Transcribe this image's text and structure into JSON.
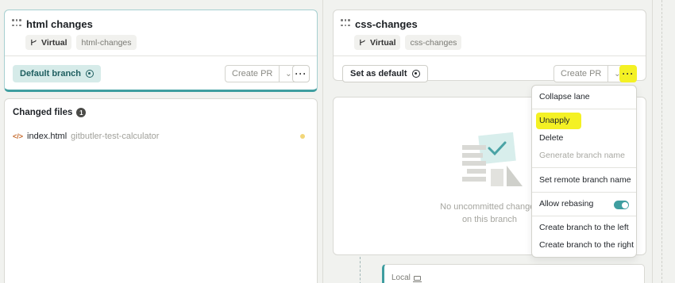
{
  "lanes": [
    {
      "title": "html changes",
      "tag_type": "Virtual",
      "tag_branch": "html-changes",
      "default_label": "Default branch",
      "create_pr": "Create PR"
    },
    {
      "title": "css-changes",
      "tag_type": "Virtual",
      "tag_branch": "css-changes",
      "set_default_label": "Set as default",
      "create_pr": "Create PR"
    }
  ],
  "files_panel": {
    "title": "Changed files",
    "count": "1",
    "files": [
      {
        "name": "index.html",
        "path": "gitbutler-test-calculator"
      }
    ]
  },
  "empty_state": {
    "line1": "No uncommitted changes",
    "line2": "on this branch"
  },
  "commits": {
    "local_label": "Local"
  },
  "menu": {
    "items": [
      {
        "label": "Collapse lane"
      },
      {
        "label": "Unapply"
      },
      {
        "label": "Delete"
      },
      {
        "label": "Generate branch name",
        "disabled": true
      },
      {
        "label": "Set remote branch name"
      },
      {
        "label": "Allow rebasing",
        "toggle": true
      },
      {
        "label": "Create branch to the left"
      },
      {
        "label": "Create branch to the right"
      }
    ]
  },
  "colors": {
    "accent": "#3f9ea0",
    "highlight": "#f4f124",
    "modified_dot": "#f2d679"
  },
  "icons": {
    "drag": "drag-handle-icon",
    "branch": "branch-icon",
    "target": "target-icon",
    "more": "more-icon",
    "caret": "chevron-down-icon",
    "code": "code-file-icon",
    "laptop": "laptop-icon"
  }
}
